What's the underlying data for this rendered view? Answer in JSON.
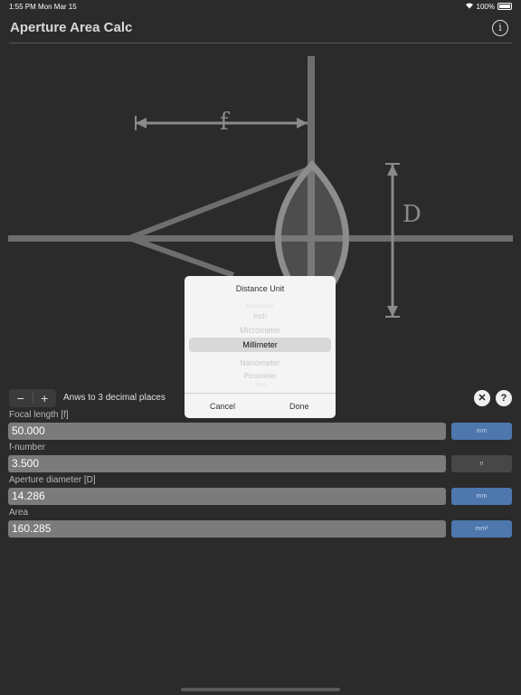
{
  "status": {
    "time": "1:55 PM",
    "date": "Mon Mar 15",
    "battery": "100%"
  },
  "app": {
    "title": "Aperture Area Calc",
    "info_icon": "info-circle-icon"
  },
  "diagram": {
    "focal_label": "f",
    "diameter_label": "D"
  },
  "toolbar": {
    "minus": "−",
    "plus": "+",
    "decimals_text": "Anws to 3 decimal places",
    "clear_icon": "✕",
    "help_icon": "?"
  },
  "fields": [
    {
      "label": "Focal length [f]",
      "value": "50.000",
      "unit": "mm",
      "unit_style": "blue"
    },
    {
      "label": "f-number",
      "value": "3.500",
      "unit": "n",
      "unit_style": "grey"
    },
    {
      "label": "Aperture diameter [D]",
      "value": "14.286",
      "unit": "mm",
      "unit_style": "blue"
    },
    {
      "label": "Area",
      "value": "160.285",
      "unit": "mm²",
      "unit_style": "blue"
    }
  ],
  "picker": {
    "title": "Distance Unit",
    "options": [
      "Micrometer",
      "Inch",
      "Micrometer",
      "Millimeter",
      "Nanometer",
      "Picometer",
      "Yard"
    ],
    "selected": "Millimeter",
    "cancel": "Cancel",
    "done": "Done"
  },
  "colors": {
    "background": "#2b2b2b",
    "accent_blue": "#4d77ad",
    "diagram_gray": "#6e6e6e"
  }
}
